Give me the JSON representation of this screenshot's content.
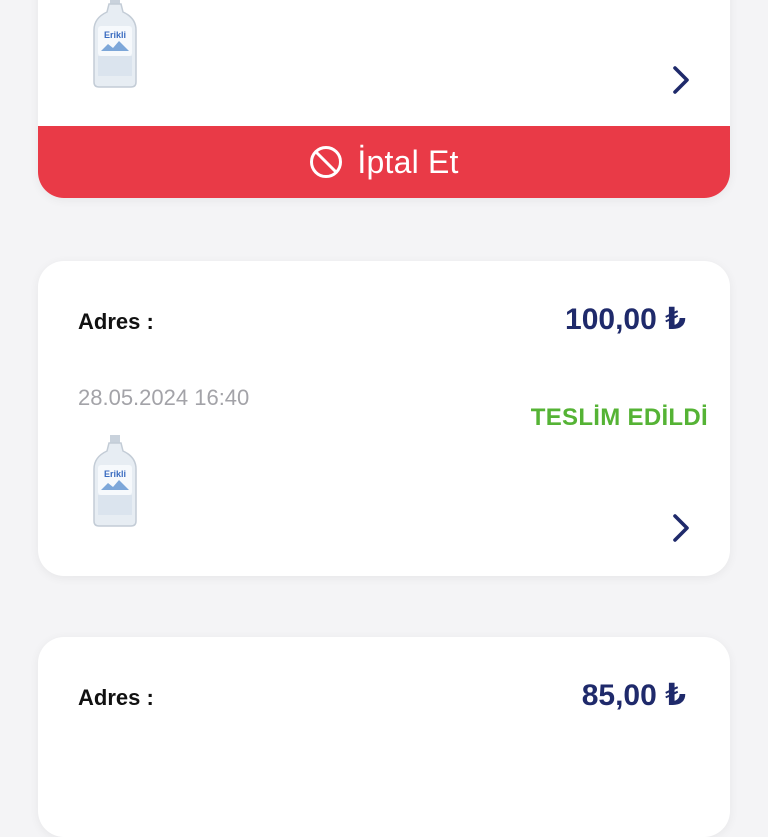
{
  "orders": [
    {
      "product_icon": "erikli-water-bottle",
      "product_brand": "Erikli",
      "cancel_label": "İptal Et",
      "cancel_icon": "ban-icon"
    },
    {
      "address_label": "Adres :",
      "price": "100,00 ₺",
      "date": "28.05.2024 16:40",
      "status": "TESLIM EDILDI",
      "status_display": "TESLİM EDİLDİ",
      "product_icon": "erikli-water-bottle",
      "product_brand": "Erikli"
    },
    {
      "address_label": "Adres :",
      "price": "85,00 ₺"
    }
  ],
  "colors": {
    "cancel": "#e93a47",
    "price": "#1f2a6b",
    "status_delivered": "#55b335",
    "date": "#a3a3a8",
    "background": "#f4f4f6"
  }
}
